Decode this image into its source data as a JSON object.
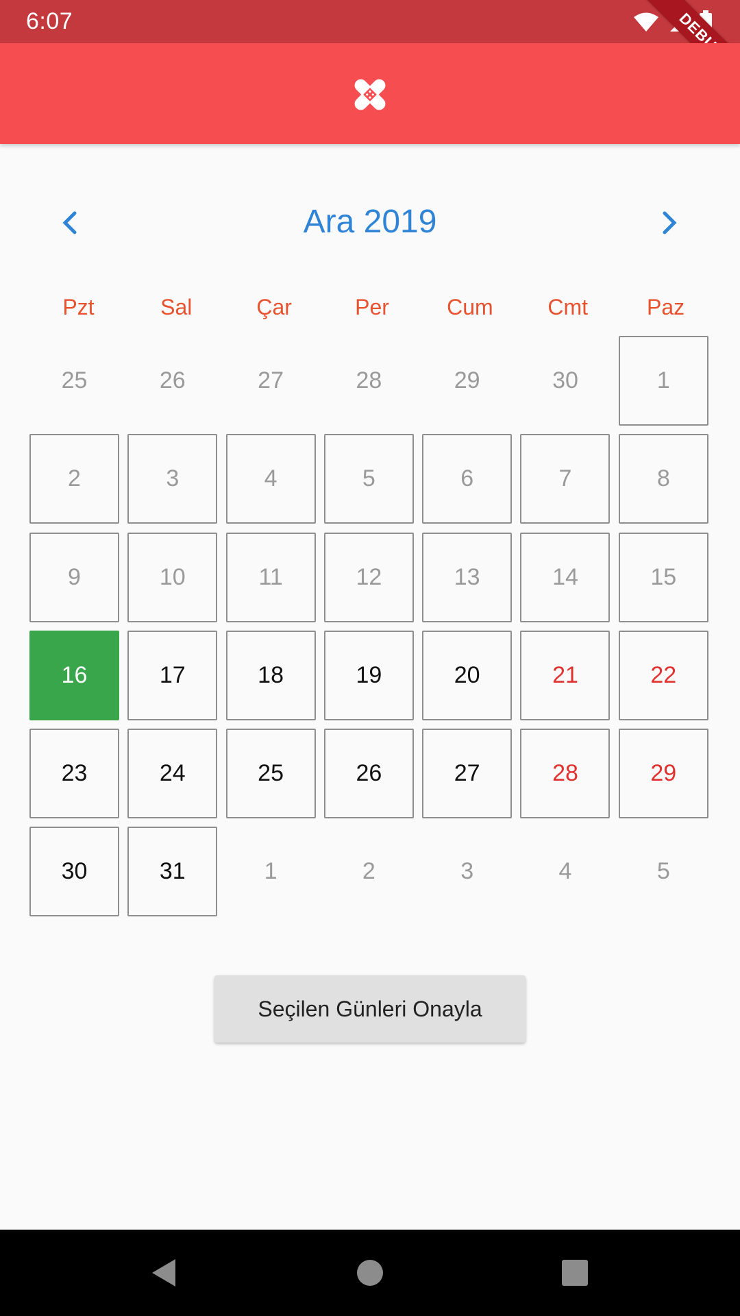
{
  "status_bar": {
    "time": "6:07",
    "debug_label": "DEBUG"
  },
  "app_bar": {
    "logo_icon": "bandage-cross-icon"
  },
  "calendar": {
    "month_title": "Ara 2019",
    "prev_icon": "chevron-left-icon",
    "next_icon": "chevron-right-icon",
    "weekdays": [
      "Pzt",
      "Sal",
      "Çar",
      "Per",
      "Cum",
      "Cmt",
      "Paz"
    ],
    "days": [
      {
        "label": "25",
        "state": "outside"
      },
      {
        "label": "26",
        "state": "outside"
      },
      {
        "label": "27",
        "state": "outside"
      },
      {
        "label": "28",
        "state": "outside"
      },
      {
        "label": "29",
        "state": "outside"
      },
      {
        "label": "30",
        "state": "outside"
      },
      {
        "label": "1",
        "state": "past"
      },
      {
        "label": "2",
        "state": "past"
      },
      {
        "label": "3",
        "state": "past"
      },
      {
        "label": "4",
        "state": "past"
      },
      {
        "label": "5",
        "state": "past"
      },
      {
        "label": "6",
        "state": "past"
      },
      {
        "label": "7",
        "state": "past"
      },
      {
        "label": "8",
        "state": "past"
      },
      {
        "label": "9",
        "state": "past"
      },
      {
        "label": "10",
        "state": "past"
      },
      {
        "label": "11",
        "state": "past"
      },
      {
        "label": "12",
        "state": "past"
      },
      {
        "label": "13",
        "state": "past"
      },
      {
        "label": "14",
        "state": "past"
      },
      {
        "label": "15",
        "state": "past"
      },
      {
        "label": "16",
        "state": "today"
      },
      {
        "label": "17",
        "state": "active"
      },
      {
        "label": "18",
        "state": "active"
      },
      {
        "label": "19",
        "state": "active"
      },
      {
        "label": "20",
        "state": "active"
      },
      {
        "label": "21",
        "state": "weekend"
      },
      {
        "label": "22",
        "state": "weekend"
      },
      {
        "label": "23",
        "state": "active"
      },
      {
        "label": "24",
        "state": "active"
      },
      {
        "label": "25",
        "state": "active"
      },
      {
        "label": "26",
        "state": "active"
      },
      {
        "label": "27",
        "state": "active"
      },
      {
        "label": "28",
        "state": "weekend"
      },
      {
        "label": "29",
        "state": "weekend"
      },
      {
        "label": "30",
        "state": "active"
      },
      {
        "label": "31",
        "state": "active"
      },
      {
        "label": "1",
        "state": "outside"
      },
      {
        "label": "2",
        "state": "outside"
      },
      {
        "label": "3",
        "state": "outside"
      },
      {
        "label": "4",
        "state": "outside"
      },
      {
        "label": "5",
        "state": "outside"
      }
    ]
  },
  "confirm_button": {
    "label": "Seçilen Günleri Onayla"
  },
  "colors": {
    "app_bar": "#f64d51",
    "status_bar": "#c4393d",
    "month_title": "#2f84d6",
    "weekday": "#e8532f",
    "today": "#3aa64b",
    "weekend": "#e0322f"
  }
}
